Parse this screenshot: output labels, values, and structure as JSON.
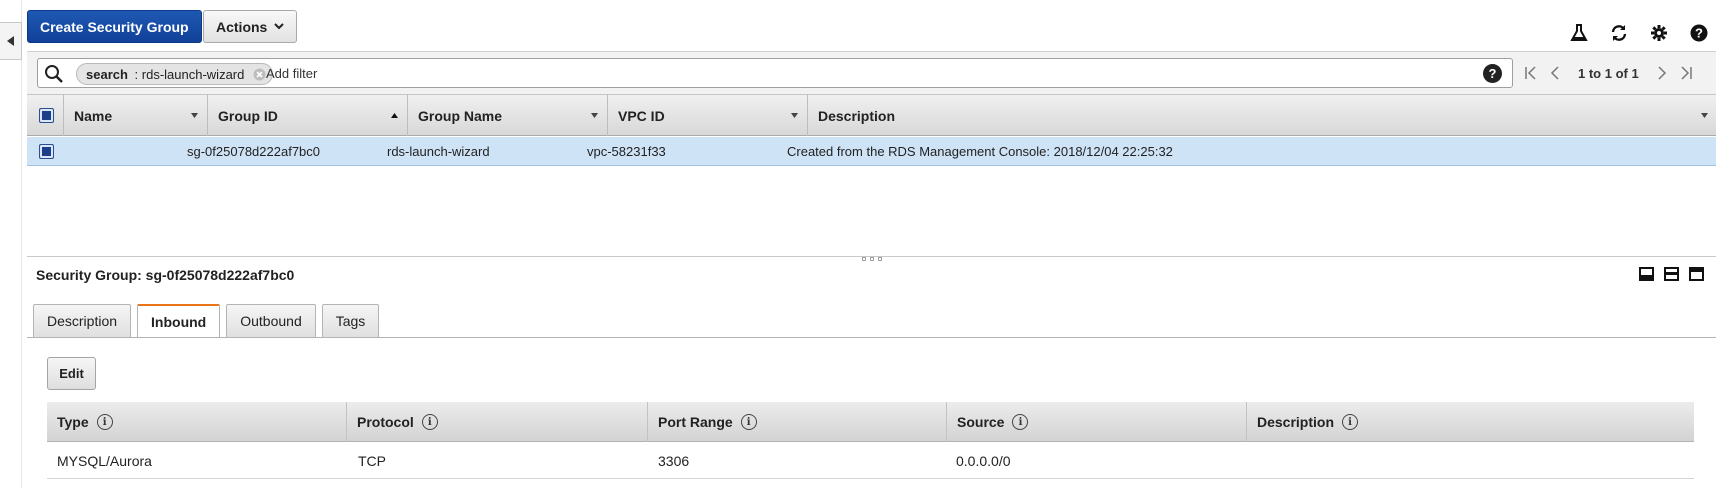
{
  "toolbar": {
    "create_label": "Create Security Group",
    "actions_label": "Actions",
    "icons": [
      "flask-icon",
      "refresh-icon",
      "gear-icon",
      "help-icon"
    ]
  },
  "filter": {
    "token_key": "search",
    "token_sep": " : ",
    "token_value": "rds-launch-wizard",
    "placeholder": "Add filter",
    "help": "?"
  },
  "pager": {
    "text": "1 to 1 of 1"
  },
  "grid": {
    "columns": [
      "Name",
      "Group ID",
      "Group Name",
      "VPC ID",
      "Description"
    ],
    "rows": [
      {
        "name": "",
        "group_id": "sg-0f25078d222af7bc0",
        "group_name": "rds-launch-wizard",
        "vpc_id": "vpc-58231f33",
        "description": "Created from the RDS Management Console: 2018/12/04 22:25:32",
        "selected": true
      }
    ]
  },
  "detail": {
    "title": "Security Group: sg-0f25078d222af7bc0",
    "tabs": [
      "Description",
      "Inbound",
      "Outbound",
      "Tags"
    ],
    "active_tab": "Inbound",
    "edit_label": "Edit",
    "rules": {
      "columns": [
        "Type",
        "Protocol",
        "Port Range",
        "Source",
        "Description"
      ],
      "rows": [
        {
          "type": "MYSQL/Aurora",
          "protocol": "TCP",
          "port_range": "3306",
          "source": "0.0.0.0/0",
          "description": ""
        }
      ]
    }
  },
  "colors": {
    "primary": "#114199",
    "selected_row": "#cfe3f7",
    "active_tab_accent": "#e8751a"
  }
}
